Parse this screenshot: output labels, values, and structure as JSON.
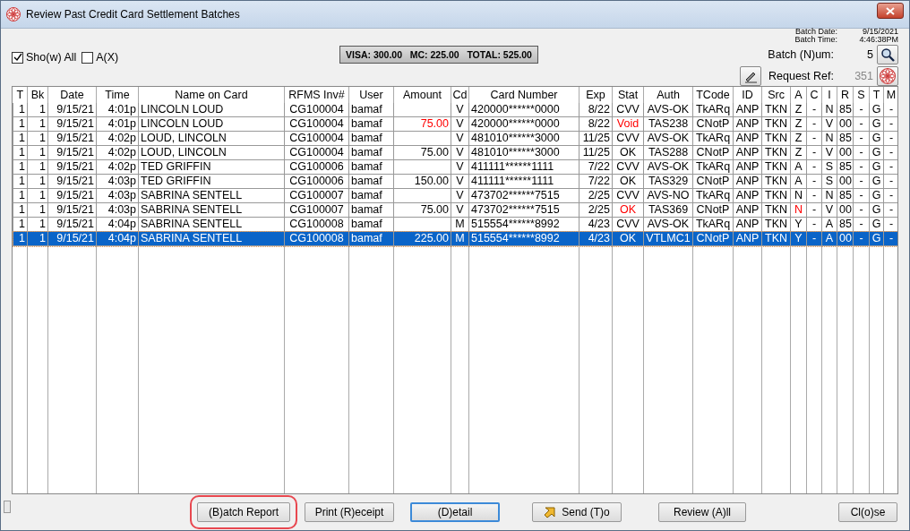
{
  "window": {
    "title": "Review Past Credit Card Settlement Batches"
  },
  "batch_info": {
    "date_label": "Batch Date:",
    "date": "9/15/2021",
    "time_label": "Batch Time:",
    "time": "4:46:38PM"
  },
  "options": [
    {
      "label": "Sho(w) All",
      "checked": true
    },
    {
      "label": "A(X)",
      "checked": false
    }
  ],
  "totals": "VISA: 300.00   MC: 225.00   TOTAL: 525.00",
  "batch_num": {
    "label": "Batch (N)um:",
    "value": "5"
  },
  "request_ref": {
    "label": "Request Ref:",
    "value": "351"
  },
  "table": {
    "columns": [
      "T",
      "Bk",
      "Date",
      "Time",
      "Name on Card",
      "RFMS Inv#",
      "User",
      "Amount",
      "Cd",
      "Card Number",
      "Exp",
      "Stat",
      "Auth",
      "TCode",
      "ID",
      "Src",
      "A",
      "C",
      "I",
      "R",
      "S",
      "T",
      "M"
    ],
    "rows": [
      {
        "selected": false,
        "cells": [
          "1",
          "1",
          "9/15/21",
          "4:01p",
          "LINCOLN LOUD",
          "CG100004",
          "bamaf",
          null,
          "V",
          "420000******0000",
          "8/22",
          "CVV",
          "AVS-OK",
          "TkARq",
          "ANP",
          "TKN",
          "Z",
          "-",
          "N",
          "85",
          "-",
          "G",
          "-"
        ]
      },
      {
        "selected": false,
        "cells": [
          "1",
          "1",
          "9/15/21",
          "4:01p",
          "LINCOLN LOUD",
          "CG100004",
          "bamaf",
          {
            "text": "75.00",
            "alert": true
          },
          "V",
          "420000******0000",
          "8/22",
          {
            "text": "Void",
            "alert": true
          },
          "TAS238",
          "CNotP",
          "ANP",
          "TKN",
          "Z",
          "-",
          "V",
          "00",
          "-",
          "G",
          "-"
        ]
      },
      {
        "selected": false,
        "cells": [
          "1",
          "1",
          "9/15/21",
          "4:02p",
          "LOUD, LINCOLN",
          "CG100004",
          "bamaf",
          null,
          "V",
          "481010******3000",
          "11/25",
          "CVV",
          "AVS-OK",
          "TkARq",
          "ANP",
          "TKN",
          "Z",
          "-",
          "N",
          "85",
          "-",
          "G",
          "-"
        ]
      },
      {
        "selected": false,
        "cells": [
          "1",
          "1",
          "9/15/21",
          "4:02p",
          "LOUD, LINCOLN",
          "CG100004",
          "bamaf",
          "75.00",
          "V",
          "481010******3000",
          "11/25",
          "OK",
          "TAS288",
          "CNotP",
          "ANP",
          "TKN",
          "Z",
          "-",
          "V",
          "00",
          "-",
          "G",
          "-"
        ]
      },
      {
        "selected": false,
        "cells": [
          "1",
          "1",
          "9/15/21",
          "4:02p",
          "TED GRIFFIN",
          "CG100006",
          "bamaf",
          null,
          "V",
          "411111******1111",
          "7/22",
          "CVV",
          "AVS-OK",
          "TkARq",
          "ANP",
          "TKN",
          "A",
          "-",
          "S",
          "85",
          "-",
          "G",
          "-"
        ]
      },
      {
        "selected": false,
        "cells": [
          "1",
          "1",
          "9/15/21",
          "4:03p",
          "TED GRIFFIN",
          "CG100006",
          "bamaf",
          "150.00",
          "V",
          "411111******1111",
          "7/22",
          "OK",
          "TAS329",
          "CNotP",
          "ANP",
          "TKN",
          "A",
          "-",
          "S",
          "00",
          "-",
          "G",
          "-"
        ]
      },
      {
        "selected": false,
        "cells": [
          "1",
          "1",
          "9/15/21",
          "4:03p",
          "SABRINA SENTELL",
          "CG100007",
          "bamaf",
          null,
          "V",
          "473702******7515",
          "2/25",
          "CVV",
          "AVS-NO",
          "TkARq",
          "ANP",
          "TKN",
          "N",
          "-",
          "N",
          "85",
          "-",
          "G",
          "-"
        ]
      },
      {
        "selected": false,
        "cells": [
          "1",
          "1",
          "9/15/21",
          "4:03p",
          "SABRINA SENTELL",
          "CG100007",
          "bamaf",
          "75.00",
          "V",
          "473702******7515",
          "2/25",
          {
            "text": "OK",
            "alert": true
          },
          "TAS369",
          "CNotP",
          "ANP",
          "TKN",
          {
            "text": "N",
            "alert": true
          },
          "-",
          "V",
          "00",
          "-",
          "G",
          "-"
        ]
      },
      {
        "selected": false,
        "cells": [
          "1",
          "1",
          "9/15/21",
          "4:04p",
          "SABRINA SENTELL",
          "CG100008",
          "bamaf",
          null,
          "M",
          "515554******8992",
          "4/23",
          "CVV",
          "AVS-OK",
          "TkARq",
          "ANP",
          "TKN",
          "Y",
          "-",
          "A",
          "85",
          "-",
          "G",
          "-"
        ]
      },
      {
        "selected": true,
        "cells": [
          "1",
          "1",
          "9/15/21",
          "4:04p",
          "SABRINA SENTELL",
          "CG100008",
          "bamaf",
          "225.00",
          "M",
          "515554******8992",
          "4/23",
          "OK",
          "VTLMC1",
          "CNotP",
          "ANP",
          "TKN",
          "Y",
          "-",
          "A",
          "00",
          "-",
          "G",
          "-"
        ]
      }
    ]
  },
  "buttons": [
    {
      "label": "(B)atch Report",
      "kind": "highlighted"
    },
    {
      "label": "Print (R)eceipt",
      "kind": "plain"
    },
    {
      "label": "(D)etail",
      "kind": "default"
    },
    {
      "label": "Send (T)o",
      "kind": "icon"
    },
    {
      "label": "Review (A)ll",
      "kind": "plain"
    },
    {
      "label": "Cl(o)se",
      "kind": "plain"
    }
  ]
}
